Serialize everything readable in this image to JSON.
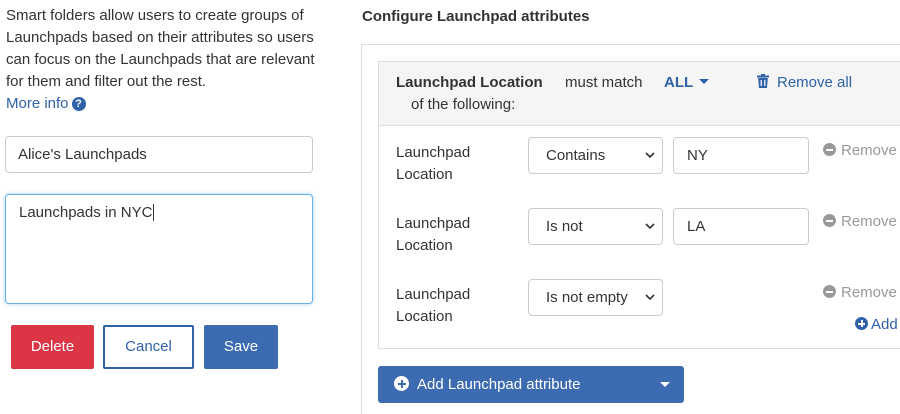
{
  "left": {
    "description": "Smart folders allow users to create groups of Launchpads based on their attributes so users can focus on the Launchpads that are relevant for them and filter out the rest.",
    "more_info_label": "More info",
    "info_glyph": "?",
    "name_value": "Alice's Launchpads",
    "description_value": "Launchpads in NYC",
    "buttons": {
      "delete": "Delete",
      "cancel": "Cancel",
      "save": "Save"
    }
  },
  "config": {
    "title": "Configure Launchpad attributes",
    "group": {
      "attribute": "Launchpad Location",
      "must_match": "must match",
      "match_mode": "ALL",
      "remove_all": "Remove all",
      "of_following": "of the following:"
    },
    "rules": [
      {
        "label_line1": "Launchpad",
        "label_line2": "Location",
        "operator": "Contains",
        "value": "NY",
        "remove": "Remove"
      },
      {
        "label_line1": "Launchpad",
        "label_line2": "Location",
        "operator": "Is not",
        "value": "LA",
        "remove": "Remove"
      },
      {
        "label_line1": "Launchpad",
        "label_line2": "Location",
        "operator": "Is not empty",
        "value": null,
        "remove": "Remove"
      }
    ],
    "add_label": "Add",
    "add_attribute_button": "Add Launchpad attribute"
  },
  "colors": {
    "link": "#2f62a8",
    "primary": "#3d6bb2",
    "danger": "#dc3545",
    "muted": "#999999"
  },
  "icons": [
    "info-icon",
    "trash-icon",
    "minus-circle-icon",
    "plus-circle-icon",
    "chevron-down-icon",
    "caret-down-icon"
  ]
}
